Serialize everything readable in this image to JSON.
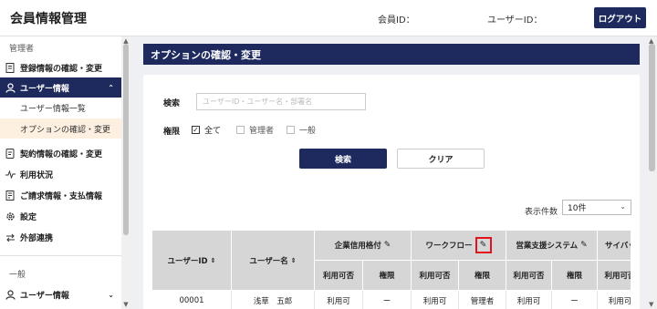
{
  "header": {
    "app_title": "会員情報管理",
    "member_id_label": "会員ID：",
    "user_id_label": "ユーザーID：",
    "logout": "ログアウト"
  },
  "sidebar": {
    "section_admin": "管理者",
    "items": [
      {
        "label": "登録情報の確認・変更",
        "icon": "document-icon"
      },
      {
        "label": "ユーザー情報",
        "icon": "user-icon",
        "expanded": true
      },
      {
        "label": "契約情報の確認・変更",
        "icon": "contract-icon"
      },
      {
        "label": "利用状況",
        "icon": "activity-icon"
      },
      {
        "label": "ご請求情報・支払情報",
        "icon": "invoice-icon"
      },
      {
        "label": "設定",
        "icon": "gear-icon"
      },
      {
        "label": "外部連携",
        "icon": "link-icon"
      }
    ],
    "subitems": [
      "ユーザー情報一覧",
      "オプションの確認・変更"
    ],
    "section_general": "一般",
    "general_items": [
      {
        "label": "ユーザー情報",
        "icon": "user-icon"
      }
    ]
  },
  "page": {
    "title": "オプションの確認・変更"
  },
  "search": {
    "label": "検索",
    "placeholder": "ユーザーID・ユーザー名・部署名",
    "role_label": "権限",
    "roles": [
      {
        "label": "全て",
        "checked": true
      },
      {
        "label": "管理者",
        "checked": false
      },
      {
        "label": "一般",
        "checked": false
      }
    ],
    "search_button": "検索",
    "clear_button": "クリア"
  },
  "table": {
    "count_label": "表示件数",
    "count_value": "10件",
    "col_user_id": "ユーザーID",
    "col_user_name": "ユーザー名",
    "groups": [
      "企業信用格付",
      "ワークフロー",
      "営業支援システム",
      "サイバッ"
    ],
    "sub_cols": [
      "利用可否",
      "権限"
    ],
    "rows": [
      {
        "user_id": "00001",
        "user_name": "浅草　五郎",
        "cells": [
          "利用可",
          "ー",
          "利用可",
          "管理者",
          "利用可",
          "ー",
          "利用可"
        ]
      }
    ]
  },
  "colors": {
    "navy": "#1e2a5e",
    "highlight": "#e0141e",
    "selected_bg": "#fdf0e0"
  }
}
